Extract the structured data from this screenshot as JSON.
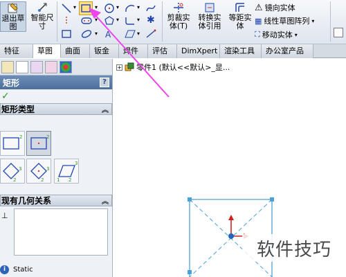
{
  "ribbon": {
    "exit_sketch_label": "退出草\n图",
    "smart_dim_label": "智能尺\n寸",
    "trim_label": "剪裁实\n体(T)",
    "convert_label": "转换实\n体引用",
    "offset_label": "等距实\n体",
    "mirror_label": "镜向实体",
    "linear_pattern_label": "线性草图阵列",
    "move_label": "移动实体"
  },
  "tabs": [
    "特征",
    "草图",
    "曲面",
    "钣金",
    "焊件",
    "评估",
    "DimXpert",
    "渲染工具",
    "办公室产品"
  ],
  "active_tab": "草图",
  "panel": {
    "title": "矩形",
    "help": "?",
    "rect_type_header": "矩形类型",
    "existing_rel_header": "现有几何关系",
    "status_text": "Static"
  },
  "tree": {
    "part_label": "零件1  (默认<<默认>_显..."
  },
  "watermark": "软件技巧",
  "colors": {
    "accent": "#ee44ee",
    "sketch_line": "#4aa0d8"
  }
}
